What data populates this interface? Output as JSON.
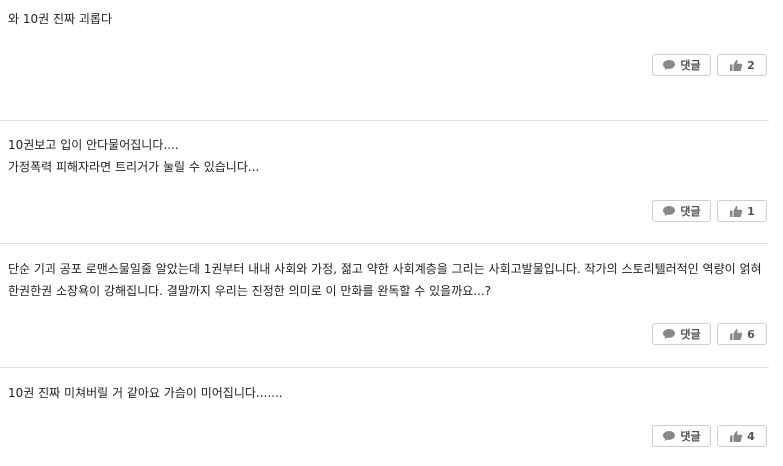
{
  "comments": [
    {
      "text": "와 10권 진짜 괴롭다",
      "reply_label": "댓글",
      "like_count": "2"
    },
    {
      "text": "10권보고 입이 안다물어집니다....\n가정폭력 피해자라면 트리거가 눌릴 수 있습니다...",
      "reply_label": "댓글",
      "like_count": "1"
    },
    {
      "text": "단순 기괴 공포 로맨스물일줄 알았는데 1권부터 내내 사회와 가정, 젊고 약한 사회계층을 그리는 사회고발물입니다. 작가의 스토리텔러적인 역량이 얽혀 한권한권 소장욕이 강해집니다. 결말까지 우리는 진정한 의미로 이 만화를 완독할 수 있을까요...?",
      "reply_label": "댓글",
      "like_count": "6"
    },
    {
      "text": "10권 진짜 미쳐버릴 거 같아요 가슴이 미어집니다.......",
      "reply_label": "댓글",
      "like_count": "4"
    }
  ],
  "icons": {
    "reply": "speech-bubble-icon",
    "like": "thumbs-up-icon"
  },
  "colors": {
    "icon": "#888888",
    "border": "#cfcfcf",
    "divider": "#dddddd"
  }
}
